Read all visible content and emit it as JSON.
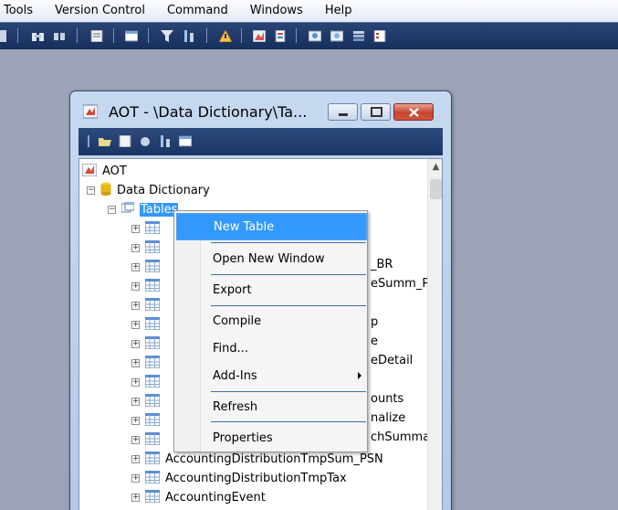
{
  "menubar": {
    "items": [
      "Tools",
      "Version Control",
      "Command",
      "Windows",
      "Help"
    ]
  },
  "aot_window": {
    "title": "AOT - \\Data Dictionary\\Ta..."
  },
  "tree": {
    "root": "AOT",
    "data_dictionary": "Data Dictionary",
    "tables": "Tables",
    "partial_labels": [
      "_BR",
      "eSumm_P",
      "p",
      "e",
      "eDetail",
      "ounts",
      "nalize",
      "chSumma"
    ],
    "items": [
      "AccountingDistributionTmpSum_PSN",
      "AccountingDistributionTmpTax",
      "AccountingEvent"
    ]
  },
  "context_menu": {
    "new_table": "New Table",
    "open_new_window": "Open New Window",
    "export": "Export",
    "compile": "Compile",
    "find": "Find...",
    "add_ins": "Add-Ins",
    "refresh": "Refresh",
    "properties": "Properties"
  },
  "colors": {
    "selection": "#3399ff",
    "toolbar": "#1e3a6a",
    "workspace": "#9da3b9"
  }
}
